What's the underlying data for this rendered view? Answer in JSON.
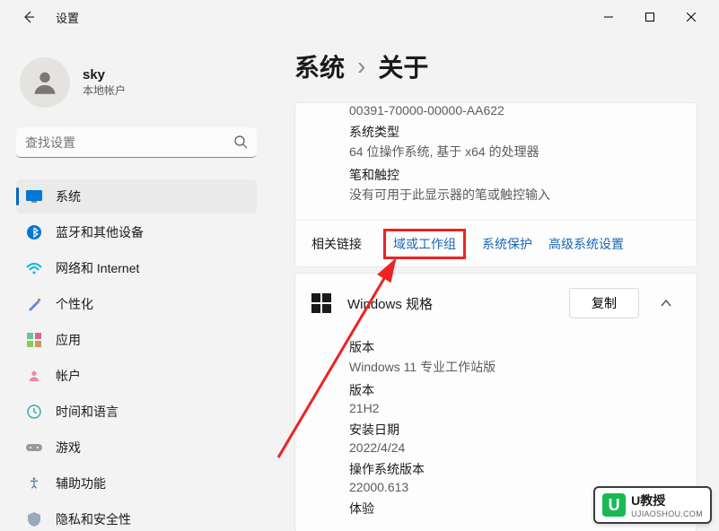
{
  "window": {
    "title": "设置"
  },
  "user": {
    "name": "sky",
    "type": "本地帐户"
  },
  "search": {
    "placeholder": "查找设置"
  },
  "nav": [
    {
      "label": "系统",
      "icon": "system"
    },
    {
      "label": "蓝牙和其他设备",
      "icon": "bluetooth"
    },
    {
      "label": "网络和 Internet",
      "icon": "network"
    },
    {
      "label": "个性化",
      "icon": "personalize"
    },
    {
      "label": "应用",
      "icon": "apps"
    },
    {
      "label": "帐户",
      "icon": "accounts"
    },
    {
      "label": "时间和语言",
      "icon": "time"
    },
    {
      "label": "游戏",
      "icon": "gaming"
    },
    {
      "label": "辅助功能",
      "icon": "accessibility"
    },
    {
      "label": "隐私和安全性",
      "icon": "privacy"
    }
  ],
  "breadcrumb": {
    "root": "系统",
    "current": "关于"
  },
  "deviceSpecs": {
    "productId": "00391-70000-00000-AA622",
    "systemTypeLabel": "系统类型",
    "systemType": "64 位操作系统, 基于 x64 的处理器",
    "penTouchLabel": "笔和触控",
    "penTouch": "没有可用于此显示器的笔或触控输入"
  },
  "related": {
    "label": "相关链接",
    "domain": "域或工作组",
    "protection": "系统保护",
    "advanced": "高级系统设置"
  },
  "winSpecs": {
    "title": "Windows 规格",
    "copy": "复制",
    "editionLabel": "版本",
    "edition": "Windows 11 专业工作站版",
    "versionLabel": "版本",
    "version": "21H2",
    "installLabel": "安装日期",
    "install": "2022/4/24",
    "osBuildLabel": "操作系统版本",
    "osBuild": "22000.613",
    "expLabel": "体验"
  },
  "watermark": {
    "name": "U教授",
    "sub": "UJIAOSHOU.COM"
  }
}
